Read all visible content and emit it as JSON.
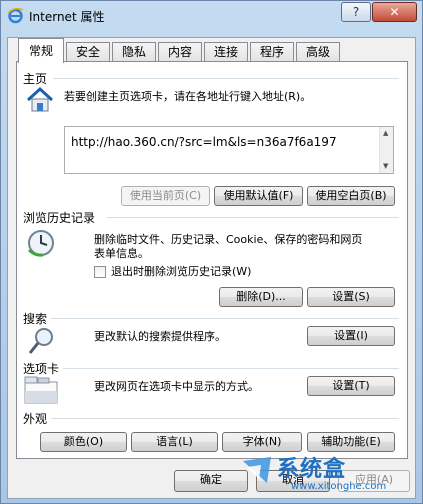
{
  "window": {
    "title": "Internet 属性",
    "help_label": "?",
    "close_label": "✕"
  },
  "tabs": [
    {
      "label": "常规",
      "active": true
    },
    {
      "label": "安全"
    },
    {
      "label": "隐私"
    },
    {
      "label": "内容"
    },
    {
      "label": "连接"
    },
    {
      "label": "程序"
    },
    {
      "label": "高级"
    }
  ],
  "homepage": {
    "section_title": "主页",
    "description": "若要创建主页选项卡，请在各地址行键入地址(R)。",
    "url": "http://hao.360.cn/?src=lm&ls=n36a7f6a197",
    "use_current_label": "使用当前页(C)",
    "use_default_label": "使用默认值(F)",
    "use_blank_label": "使用空白页(B)"
  },
  "history": {
    "section_title": "浏览历史记录",
    "description_line1": "删除临时文件、历史记录、Cookie、保存的密码和网页",
    "description_line2": "表单信息。",
    "delete_on_exit_label": "退出时删除浏览历史记录(W)",
    "delete_label": "删除(D)...",
    "settings_label": "设置(S)"
  },
  "search": {
    "section_title": "搜索",
    "description": "更改默认的搜索提供程序。",
    "settings_label": "设置(I)"
  },
  "tabs_section": {
    "section_title": "选项卡",
    "description": "更改网页在选项卡中显示的方式。",
    "settings_label": "设置(T)"
  },
  "appearance": {
    "section_title": "外观",
    "colors_label": "颜色(O)",
    "languages_label": "语言(L)",
    "fonts_label": "字体(N)",
    "accessibility_label": "辅助功能(E)"
  },
  "footer": {
    "ok_label": "确定",
    "cancel_label": "取消",
    "apply_label": "应用(A)"
  },
  "watermark": {
    "text": "系统盒",
    "url": "www.xitonghe.com"
  }
}
